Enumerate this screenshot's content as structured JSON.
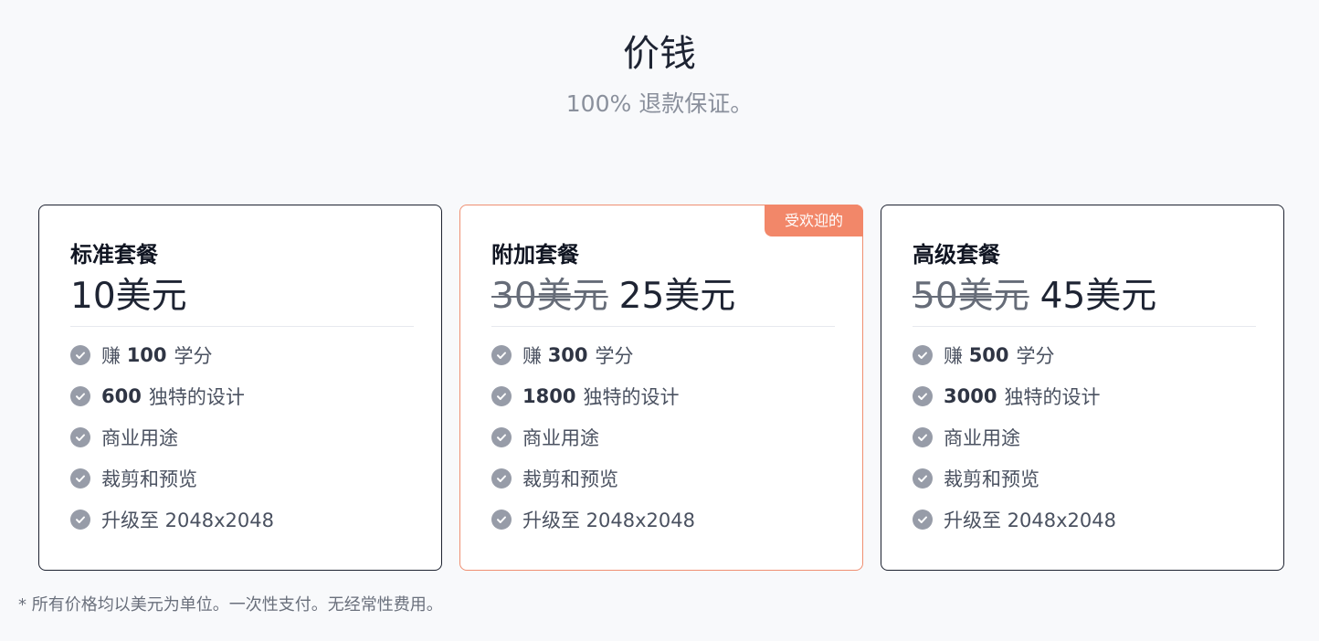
{
  "header": {
    "title": "价钱",
    "subtitle": "100% 退款保证。"
  },
  "plans": [
    {
      "name": "标准套餐",
      "price": "10美元",
      "features": [
        {
          "prefix": "赚",
          "value": "100",
          "suffix": "学分"
        },
        {
          "value": "600",
          "suffix": "独特的设计"
        },
        {
          "text": "商业用途"
        },
        {
          "text": "裁剪和预览"
        },
        {
          "text": "升级至 2048x2048"
        }
      ]
    },
    {
      "name": "附加套餐",
      "old_price": "30美元",
      "price": "25美元",
      "badge": "受欢迎的",
      "features": [
        {
          "prefix": "赚",
          "value": "300",
          "suffix": "学分"
        },
        {
          "value": "1800",
          "suffix": "独特的设计"
        },
        {
          "text": "商业用途"
        },
        {
          "text": "裁剪和预览"
        },
        {
          "text": "升级至 2048x2048"
        }
      ]
    },
    {
      "name": "高级套餐",
      "old_price": "50美元",
      "price": "45美元",
      "features": [
        {
          "prefix": "赚",
          "value": "500",
          "suffix": "学分"
        },
        {
          "value": "3000",
          "suffix": "独特的设计"
        },
        {
          "text": "商业用途"
        },
        {
          "text": "裁剪和预览"
        },
        {
          "text": "升级至 2048x2048"
        }
      ]
    }
  ],
  "footnote": "* 所有价格均以美元为单位。一次性支付。无经常性费用。",
  "icons": {
    "feature": "check-circle-icon"
  },
  "colors": {
    "popular_badge": "#f28769",
    "popular_border": "#ef8f72",
    "check_icon": "#979ca8"
  }
}
